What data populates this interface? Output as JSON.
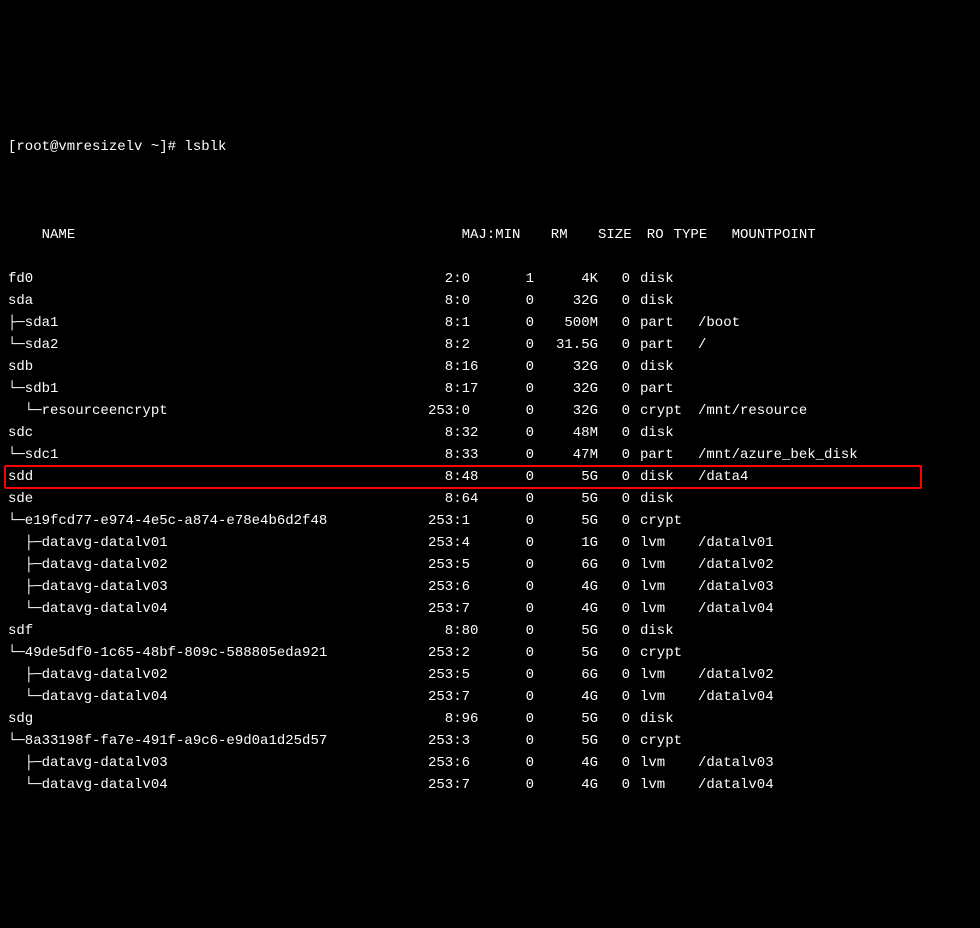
{
  "prompt": "[root@vmresizelv ~]# lsblk",
  "header": {
    "name": "NAME",
    "majmin": "MAJ:MIN",
    "rm": "RM",
    "size": "SIZE",
    "ro": "RO",
    "type": "TYPE",
    "mountpoint": "MOUNTPOINT"
  },
  "rows": [
    {
      "name": "fd0",
      "majmin": "2:0",
      "rm": "1",
      "size": "4K",
      "ro": "0",
      "type": "disk",
      "mountpoint": ""
    },
    {
      "name": "sda",
      "majmin": "8:0",
      "rm": "0",
      "size": "32G",
      "ro": "0",
      "type": "disk",
      "mountpoint": ""
    },
    {
      "name": "├─sda1",
      "majmin": "8:1",
      "rm": "0",
      "size": "500M",
      "ro": "0",
      "type": "part",
      "mountpoint": "/boot"
    },
    {
      "name": "└─sda2",
      "majmin": "8:2",
      "rm": "0",
      "size": "31.5G",
      "ro": "0",
      "type": "part",
      "mountpoint": "/"
    },
    {
      "name": "sdb",
      "majmin": "8:16",
      "rm": "0",
      "size": "32G",
      "ro": "0",
      "type": "disk",
      "mountpoint": ""
    },
    {
      "name": "└─sdb1",
      "majmin": "8:17",
      "rm": "0",
      "size": "32G",
      "ro": "0",
      "type": "part",
      "mountpoint": ""
    },
    {
      "name": "  └─resourceencrypt",
      "majmin": "253:0",
      "rm": "0",
      "size": "32G",
      "ro": "0",
      "type": "crypt",
      "mountpoint": "/mnt/resource"
    },
    {
      "name": "sdc",
      "majmin": "8:32",
      "rm": "0",
      "size": "48M",
      "ro": "0",
      "type": "disk",
      "mountpoint": ""
    },
    {
      "name": "└─sdc1",
      "majmin": "8:33",
      "rm": "0",
      "size": "47M",
      "ro": "0",
      "type": "part",
      "mountpoint": "/mnt/azure_bek_disk"
    },
    {
      "name": "sdd",
      "majmin": "8:48",
      "rm": "0",
      "size": "5G",
      "ro": "0",
      "type": "disk",
      "mountpoint": "/data4",
      "highlight": true
    },
    {
      "name": "sde",
      "majmin": "8:64",
      "rm": "0",
      "size": "5G",
      "ro": "0",
      "type": "disk",
      "mountpoint": ""
    },
    {
      "name": "└─e19fcd77-e974-4e5c-a874-e78e4b6d2f48",
      "majmin": "253:1",
      "rm": "0",
      "size": "5G",
      "ro": "0",
      "type": "crypt",
      "mountpoint": ""
    },
    {
      "name": "  ├─datavg-datalv01",
      "majmin": "253:4",
      "rm": "0",
      "size": "1G",
      "ro": "0",
      "type": "lvm",
      "mountpoint": "/datalv01"
    },
    {
      "name": "  ├─datavg-datalv02",
      "majmin": "253:5",
      "rm": "0",
      "size": "6G",
      "ro": "0",
      "type": "lvm",
      "mountpoint": "/datalv02"
    },
    {
      "name": "  ├─datavg-datalv03",
      "majmin": "253:6",
      "rm": "0",
      "size": "4G",
      "ro": "0",
      "type": "lvm",
      "mountpoint": "/datalv03"
    },
    {
      "name": "  └─datavg-datalv04",
      "majmin": "253:7",
      "rm": "0",
      "size": "4G",
      "ro": "0",
      "type": "lvm",
      "mountpoint": "/datalv04"
    },
    {
      "name": "sdf",
      "majmin": "8:80",
      "rm": "0",
      "size": "5G",
      "ro": "0",
      "type": "disk",
      "mountpoint": ""
    },
    {
      "name": "└─49de5df0-1c65-48bf-809c-588805eda921",
      "majmin": "253:2",
      "rm": "0",
      "size": "5G",
      "ro": "0",
      "type": "crypt",
      "mountpoint": ""
    },
    {
      "name": "  ├─datavg-datalv02",
      "majmin": "253:5",
      "rm": "0",
      "size": "6G",
      "ro": "0",
      "type": "lvm",
      "mountpoint": "/datalv02"
    },
    {
      "name": "  └─datavg-datalv04",
      "majmin": "253:7",
      "rm": "0",
      "size": "4G",
      "ro": "0",
      "type": "lvm",
      "mountpoint": "/datalv04"
    },
    {
      "name": "sdg",
      "majmin": "8:96",
      "rm": "0",
      "size": "5G",
      "ro": "0",
      "type": "disk",
      "mountpoint": ""
    },
    {
      "name": "└─8a33198f-fa7e-491f-a9c6-e9d0a1d25d57",
      "majmin": "253:3",
      "rm": "0",
      "size": "5G",
      "ro": "0",
      "type": "crypt",
      "mountpoint": ""
    },
    {
      "name": "  ├─datavg-datalv03",
      "majmin": "253:6",
      "rm": "0",
      "size": "4G",
      "ro": "0",
      "type": "lvm",
      "mountpoint": "/datalv03"
    },
    {
      "name": "  └─datavg-datalv04",
      "majmin": "253:7",
      "rm": "0",
      "size": "4G",
      "ro": "0",
      "type": "lvm",
      "mountpoint": "/datalv04"
    }
  ]
}
